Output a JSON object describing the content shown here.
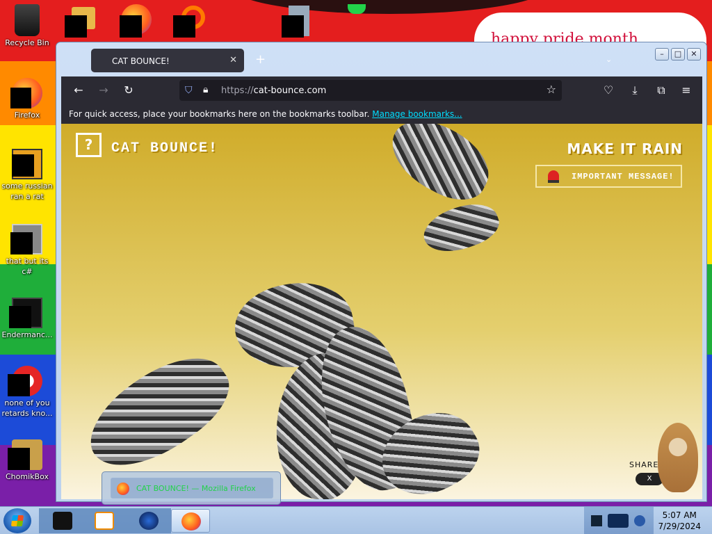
{
  "desktop": {
    "banner": "happy pride month",
    "icons": [
      {
        "name": "recycle-bin",
        "label": "Recycle Bin"
      },
      {
        "name": "firefox",
        "label": "Firefox"
      },
      {
        "name": "some-russian",
        "label": "some russian ran a rat"
      },
      {
        "name": "that-but-its",
        "label": "that but its c#"
      },
      {
        "name": "endermanc",
        "label": "Endermanc..."
      },
      {
        "name": "none-of-you",
        "label": "none of you retards kno..."
      },
      {
        "name": "chomikbox",
        "label": "ChomikBox"
      }
    ]
  },
  "browser": {
    "tab_title": "CAT BOUNCE!",
    "url_proto": "https://",
    "url_host": "cat-bounce.com",
    "bookmarks_msg": "For quick access, place your bookmarks here on the bookmarks toolbar.",
    "bookmarks_link": "Manage bookmarks..."
  },
  "page": {
    "logo_q": "?",
    "logo_text": "CAT BOUNCE!",
    "make_it_rain": "MAKE IT RAIN",
    "important": "IMPORTANT MESSAGE!",
    "share": "SHARE",
    "share_btn": "X"
  },
  "taskbar": {
    "time": "5:07 AM",
    "date": "7/29/2024",
    "preview_title": "CAT BOUNCE! — Mozilla Firefox"
  },
  "colors": {
    "accent": "#00ddff",
    "page_bg_top": "#d0ac2a",
    "navbar": "#2b2a33"
  }
}
